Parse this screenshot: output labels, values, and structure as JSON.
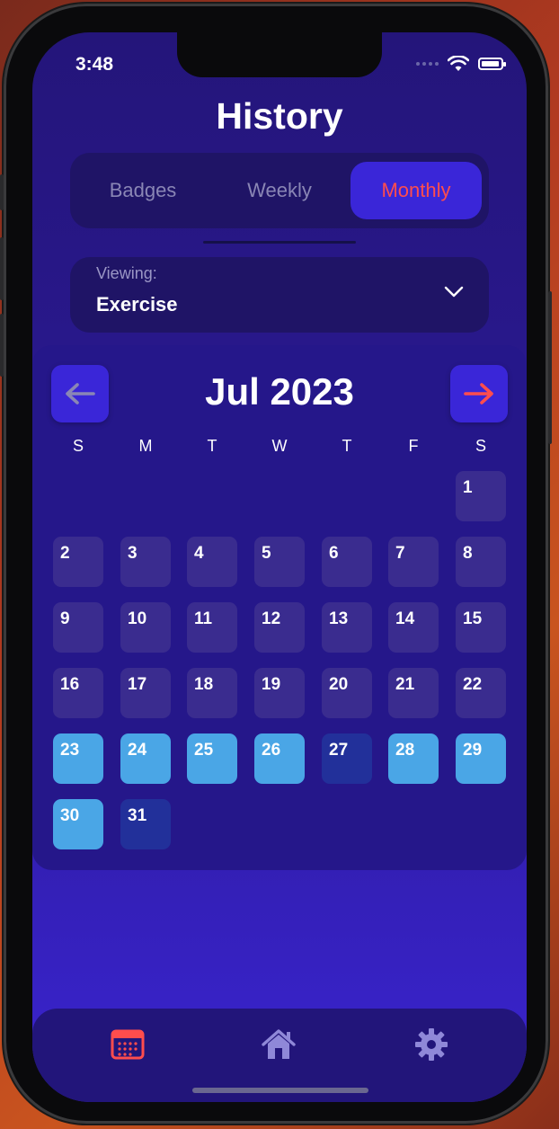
{
  "status": {
    "time": "3:48"
  },
  "header": {
    "title": "History"
  },
  "segments": {
    "items": [
      "Badges",
      "Weekly",
      "Monthly"
    ],
    "active": "Monthly"
  },
  "viewing": {
    "label": "Viewing:",
    "value": "Exercise"
  },
  "calendar": {
    "month": "Jul 2023",
    "weekdays": [
      "S",
      "M",
      "T",
      "W",
      "T",
      "F",
      "S"
    ],
    "days": [
      {
        "n": "1",
        "s": "empty"
      },
      {
        "n": "2",
        "s": "empty"
      },
      {
        "n": "3",
        "s": "empty"
      },
      {
        "n": "4",
        "s": "empty"
      },
      {
        "n": "5",
        "s": "empty"
      },
      {
        "n": "6",
        "s": "empty"
      },
      {
        "n": "7",
        "s": "empty"
      },
      {
        "n": "8",
        "s": "empty"
      },
      {
        "n": "9",
        "s": "empty"
      },
      {
        "n": "10",
        "s": "empty"
      },
      {
        "n": "11",
        "s": "empty"
      },
      {
        "n": "12",
        "s": "empty"
      },
      {
        "n": "13",
        "s": "empty"
      },
      {
        "n": "14",
        "s": "empty"
      },
      {
        "n": "15",
        "s": "empty"
      },
      {
        "n": "16",
        "s": "empty"
      },
      {
        "n": "17",
        "s": "empty"
      },
      {
        "n": "18",
        "s": "empty"
      },
      {
        "n": "19",
        "s": "empty"
      },
      {
        "n": "20",
        "s": "empty"
      },
      {
        "n": "21",
        "s": "empty"
      },
      {
        "n": "22",
        "s": "empty"
      },
      {
        "n": "23",
        "s": "done"
      },
      {
        "n": "24",
        "s": "done"
      },
      {
        "n": "25",
        "s": "done"
      },
      {
        "n": "26",
        "s": "done"
      },
      {
        "n": "27",
        "s": "partial"
      },
      {
        "n": "28",
        "s": "done"
      },
      {
        "n": "29",
        "s": "done"
      },
      {
        "n": "30",
        "s": "done"
      },
      {
        "n": "31",
        "s": "partial"
      }
    ],
    "first_weekday_index": 6
  },
  "tabs": [
    {
      "icon": "calendar-icon",
      "color": "#ff4d4d"
    },
    {
      "icon": "home-icon",
      "color": "#8f88d8"
    },
    {
      "icon": "gear-icon",
      "color": "#8f88d8"
    }
  ],
  "colors": {
    "accent": "#3a26d8",
    "active_text": "#ff4d4d",
    "done_day": "#4aa6e6",
    "partial_day": "#22309a",
    "empty_day": "#3a2c8f"
  }
}
